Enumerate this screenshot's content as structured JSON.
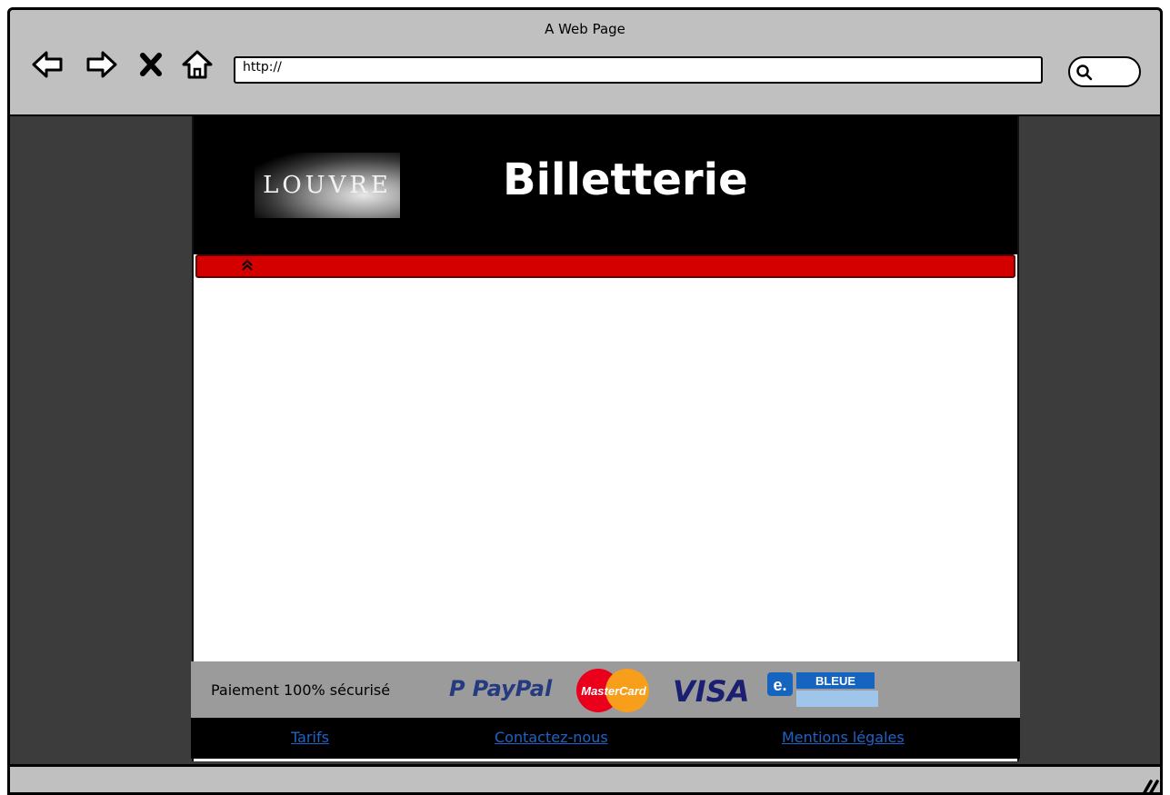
{
  "browser": {
    "title": "A Web Page",
    "url": "http://",
    "icons": {
      "back": "back-arrow-icon",
      "forward": "forward-arrow-icon",
      "stop": "close-icon",
      "home": "home-icon",
      "search": "search-icon"
    }
  },
  "site": {
    "logo_text": "LOUVRE",
    "title": "Billetterie",
    "accent_color": "#d40000",
    "scroll_up_icon": "double-chevron-up-icon"
  },
  "payment": {
    "label": "Paiement 100% sécurisé",
    "logos": {
      "paypal": "PayPal",
      "mastercard": "MasterCard",
      "visa": "VISA",
      "ebleue_e": "e.",
      "ebleue": "BLEUE"
    }
  },
  "footer": {
    "links": [
      "Tarifs",
      "Contactez-nous",
      "Mentions légales"
    ],
    "link_color": "#1e63c8"
  }
}
